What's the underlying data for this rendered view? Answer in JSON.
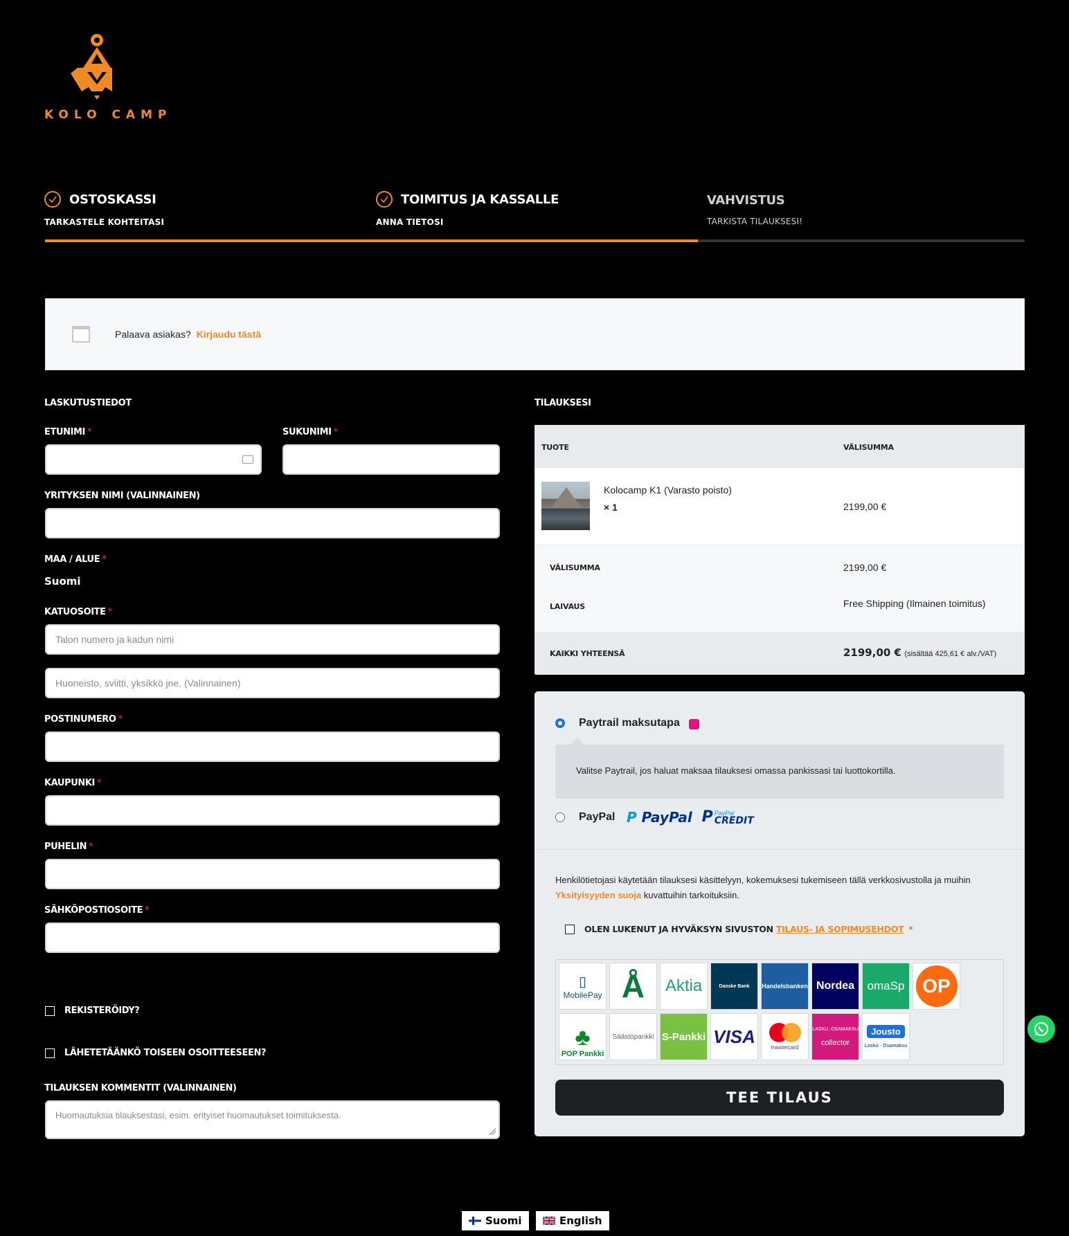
{
  "brand": {
    "name": "KOLO CAMP",
    "accent": "#f08a24"
  },
  "steps": [
    {
      "title": "OSTOSKASSI",
      "subtitle": "TARKASTELE KOHTEITASI"
    },
    {
      "title": "TOIMITUS JA KASSALLE",
      "subtitle": "ANNA TIETOSI"
    },
    {
      "title": "VAHVISTUS",
      "subtitle": "TARKISTA TILAUKSESI!"
    }
  ],
  "progress": {
    "completed_steps": 2,
    "total_steps": 3
  },
  "returning": {
    "text": "Palaava asiakas?",
    "link": "Kirjaudu tästä"
  },
  "billing": {
    "title": "LASKUTUSTIEDOT",
    "first_name": {
      "label": "ETUNIMI",
      "value": ""
    },
    "last_name": {
      "label": "SUKUNIMI",
      "value": ""
    },
    "company": {
      "label": "YRITYKSEN NIMI (VALINNAINEN)",
      "value": ""
    },
    "country": {
      "label": "MAA / ALUE",
      "value": "Suomi"
    },
    "street": {
      "label": "KATUOSOITE",
      "placeholder1": "Talon numero ja kadun nimi",
      "placeholder2": "Huoneisto, sviitti, yksikkö jne. (Valinnainen)"
    },
    "postcode": {
      "label": "POSTINUMERO",
      "value": ""
    },
    "city": {
      "label": "KAUPUNKI",
      "value": ""
    },
    "phone": {
      "label": "PUHELIN",
      "value": ""
    },
    "email": {
      "label": "SÄHKÖPOSTIOSOITE",
      "value": ""
    },
    "register": "REKISTERÖIDY?",
    "ship_other": "LÄHETETÄÄNKÖ TOISEEN OSOITTEESEEN?",
    "comments": {
      "label": "TILAUKSEN KOMMENTIT (VALINNAINEN)",
      "placeholder": "Huomautuksia tilauksestasi, esim. erityiset huomautukset toimituksesta."
    },
    "required_mark": "*"
  },
  "order": {
    "title": "TILAUKSESI",
    "col_product": "TUOTE",
    "col_subtotal": "VÄLISUMMA",
    "item": {
      "name": "Kolocamp K1 (Varasto poisto)",
      "qty": "× 1",
      "price": "2199,00 €"
    },
    "subtotal_label": "VÄLISUMMA",
    "subtotal": "2199,00 €",
    "shipping_label": "LAIVAUS",
    "shipping": "Free Shipping (Ilmainen toimitus)",
    "total_label": "KAIKKI YHTEENSÄ",
    "total": "2199,00 €",
    "tax_note": "(sisältää 425,61 € alv./VAT)"
  },
  "payment": {
    "paytrail": {
      "label": "Paytrail maksutapa",
      "desc": "Valitse Paytrail, jos haluat maksaa tilauksesi omassa pankissasi tai luottokortilla.",
      "selected": true
    },
    "paypal": {
      "label": "PayPal",
      "logo1": "PayPal",
      "logo2_top": "PayPal",
      "logo2_bottom": "CREDIT",
      "selected": false
    },
    "privacy_pre": "Henkilötietojasi käytetään tilauksesi käsittelyyn, kokemuksesi tukemiseen tällä verkkosivustolla ja muihin",
    "privacy_link": "Yksityisyyden suoja",
    "privacy_post": "kuvattuihin tarkoituksiin.",
    "terms_pre": "OLEN LUKENUT JA HYVÄKSYN SIVUSTON",
    "terms_link": "TILAUS- JA SOPIMUSEHDOT",
    "terms_mark": "*",
    "banks": [
      "MobilePay",
      "Ålandsbanken",
      "Aktia",
      "Danske Bank",
      "Handelsbanken",
      "Nordea",
      "omaSp",
      "OP",
      "POP Pankki",
      "Säästöpankki",
      "S-Pankki",
      "VISA",
      "mastercard",
      "collector",
      "Jousto"
    ],
    "bank_sublabels": {
      "collector_top": "LASKU, OSAMAKSU",
      "jousto_bottom": "Lasku · Osamaksu"
    },
    "button": "TEE TILAUS"
  },
  "languages": [
    "Suomi",
    "English"
  ]
}
